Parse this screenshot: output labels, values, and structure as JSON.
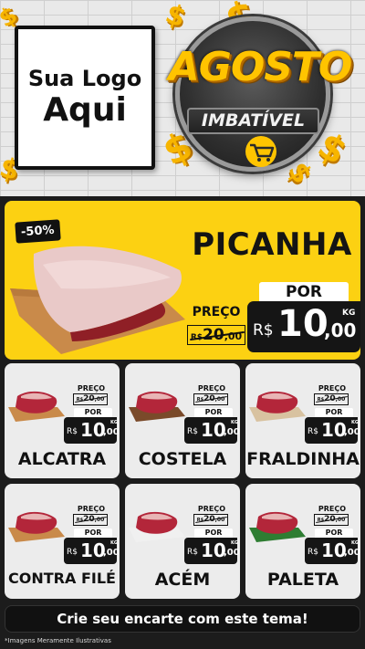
{
  "header": {
    "logo_line1": "Sua Logo",
    "logo_line2": "Aqui",
    "campaign_title": "AGOSTO",
    "campaign_subtitle": "IMBATÍVEL",
    "badge_icon": "shopping-cart-icon",
    "coin_glyph": "$"
  },
  "featured": {
    "discount": "-50%",
    "name": "PICANHA",
    "old_label": "PREÇO",
    "old_currency": "R$",
    "old_int": "20",
    "old_dec": ",00",
    "por_label": "POR",
    "currency": "R$",
    "price_int": "10",
    "price_dec": ",00",
    "unit": "KG"
  },
  "products": [
    {
      "name": "ALCATRA",
      "old_label": "PREÇO",
      "old_currency": "R$",
      "old_int": "20",
      "old_dec": ",00",
      "por_label": "POR",
      "currency": "R$",
      "price_int": "10",
      "price_dec": ",00",
      "unit": "KG"
    },
    {
      "name": "COSTELA",
      "old_label": "PREÇO",
      "old_currency": "R$",
      "old_int": "20",
      "old_dec": ",00",
      "por_label": "POR",
      "currency": "R$",
      "price_int": "10",
      "price_dec": ",00",
      "unit": "KG"
    },
    {
      "name": "FRALDINHA",
      "old_label": "PREÇO",
      "old_currency": "R$",
      "old_int": "20",
      "old_dec": ",00",
      "por_label": "POR",
      "currency": "R$",
      "price_int": "10",
      "price_dec": ",00",
      "unit": "KG"
    },
    {
      "name": "CONTRA FILÉ",
      "old_label": "PREÇO",
      "old_currency": "R$",
      "old_int": "20",
      "old_dec": ",00",
      "por_label": "POR",
      "currency": "R$",
      "price_int": "10",
      "price_dec": ",00",
      "unit": "KG"
    },
    {
      "name": "ACÉM",
      "old_label": "PREÇO",
      "old_currency": "R$",
      "old_int": "20",
      "old_dec": ",00",
      "por_label": "POR",
      "currency": "R$",
      "price_int": "10",
      "price_dec": ",00",
      "unit": "KG"
    },
    {
      "name": "PALETA",
      "old_label": "PREÇO",
      "old_currency": "R$",
      "old_int": "20",
      "old_dec": ",00",
      "por_label": "POR",
      "currency": "R$",
      "price_int": "10",
      "price_dec": ",00",
      "unit": "KG"
    }
  ],
  "footer": {
    "cta": "Crie seu encarte com este tema!",
    "disclaimer": "*Imagens Meramente Ilustrativas"
  },
  "colors": {
    "yellow": "#fcd112",
    "dark": "#151515",
    "card": "#ececec",
    "gold": "#f7b500"
  }
}
